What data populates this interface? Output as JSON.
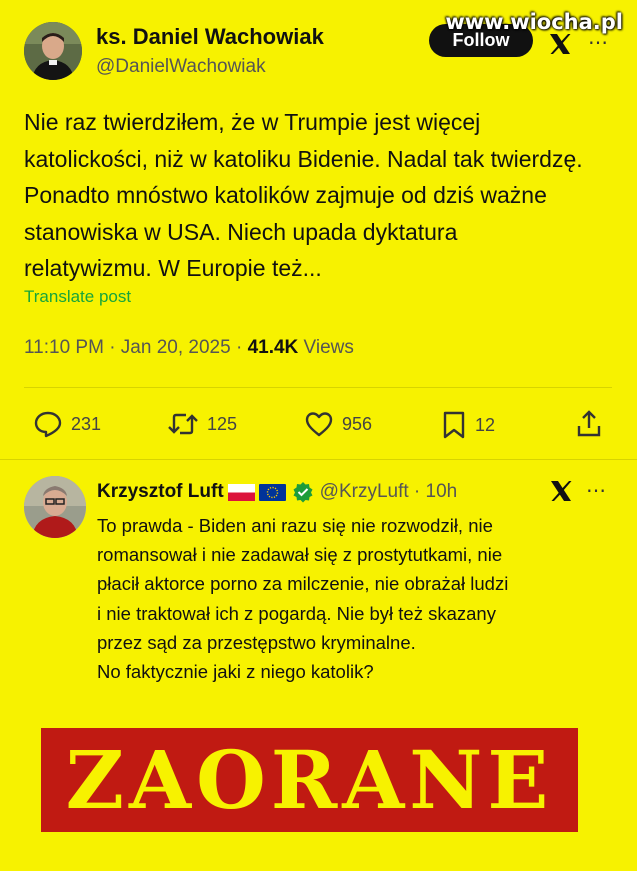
{
  "watermark": "www.wiocha.pl",
  "post": {
    "author_name": "ks. Daniel Wachowiak",
    "author_handle": "@DanielWachowiak",
    "follow_label": "Follow",
    "text": "Nie raz twierdziłem, że w Trumpie jest więcej katolickości, niż w katoliku Bidenie. Nadal tak twierdzę. Ponadto mnóstwo katolików zajmuje od dziś ważne stanowiska w USA. Niech upada dyktatura relatywizmu. W Europie też...",
    "translate_label": "Translate post",
    "time": "11:10 PM · Jan 20, 2025 · ",
    "views_count": "41.4K",
    "views_label": " Views",
    "stats": {
      "replies": "231",
      "reposts": "125",
      "likes": "956",
      "bookmarks": "12"
    }
  },
  "reply": {
    "author_name": "Krzysztof Luft",
    "handle_time": "@KrzyLuft · 10h",
    "text_lines": [
      "To prawda - Biden ani razu się nie rozwodził, nie",
      "romansował i nie zadawał się z prostytutkami, nie",
      "płacił aktorce porno za milczenie, nie obrażał ludzi",
      "i nie traktował ich z pogardą. Nie był też skazany",
      "przez sąd za przestępstwo kryminalne.",
      "No faktycznie jaki z niego katolik?"
    ]
  },
  "stamp_text": "ZAORANE",
  "colors": {
    "background": "#f7f200",
    "stamp_red": "#c01a12",
    "link_green": "#18a53a"
  }
}
